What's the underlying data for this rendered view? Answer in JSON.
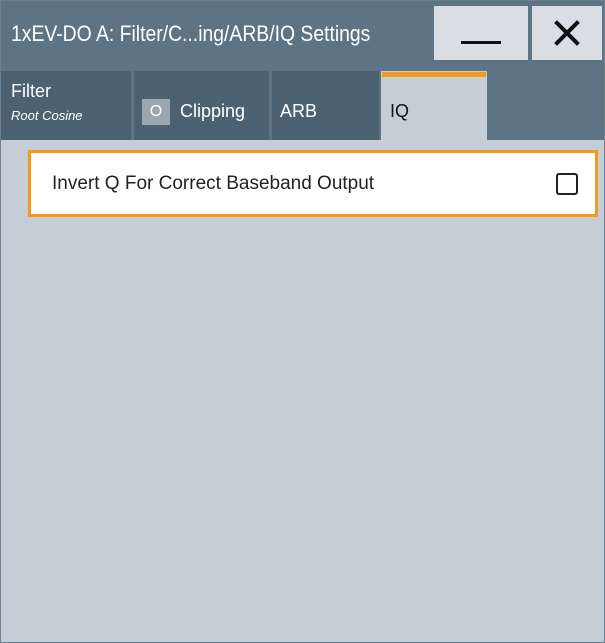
{
  "window": {
    "title": "1xEV-DO A: Filter/C...ing/ARB/IQ Settings",
    "minimize_icon": "minimize-icon",
    "close_icon": "close-icon"
  },
  "tabs": [
    {
      "label": "Filter",
      "sublabel": "Root Cosine",
      "active": false
    },
    {
      "label": "Clipping",
      "badge": "O",
      "active": false
    },
    {
      "label": "ARB",
      "active": false
    },
    {
      "label": "IQ",
      "active": true
    }
  ],
  "iq": {
    "invert_q_label": "Invert Q For Correct Baseband Output",
    "invert_q_checked": false
  },
  "colors": {
    "accent": "#f39a1d",
    "titlebar": "#5e7383",
    "tab_inactive": "#4d6271",
    "panel": "#c5ced6"
  }
}
